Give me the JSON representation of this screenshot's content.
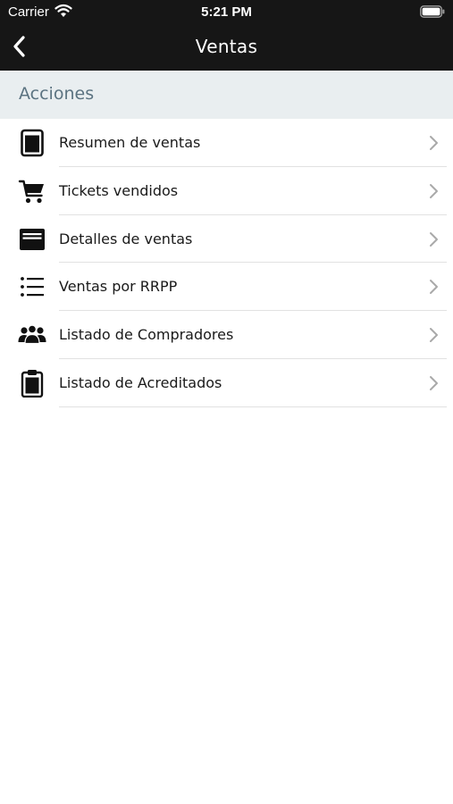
{
  "status_bar": {
    "carrier": "Carrier",
    "time": "5:21 PM"
  },
  "nav": {
    "title": "Ventas",
    "back_icon": "chevron-left-icon"
  },
  "section": {
    "title": "Acciones"
  },
  "items": [
    {
      "label": "Resumen de ventas",
      "icon": "tablet-icon"
    },
    {
      "label": "Tickets vendidos",
      "icon": "cart-icon"
    },
    {
      "label": "Detalles de ventas",
      "icon": "inbox-icon"
    },
    {
      "label": "Ventas por RRPP",
      "icon": "list-icon"
    },
    {
      "label": "Listado de Compradores",
      "icon": "users-icon"
    },
    {
      "label": "Listado de Acreditados",
      "icon": "clipboard-icon"
    }
  ],
  "colors": {
    "topbar": "#161616",
    "section_bg": "#e9eef0",
    "section_text": "#5b7381",
    "chevron": "#a9a9a9"
  }
}
